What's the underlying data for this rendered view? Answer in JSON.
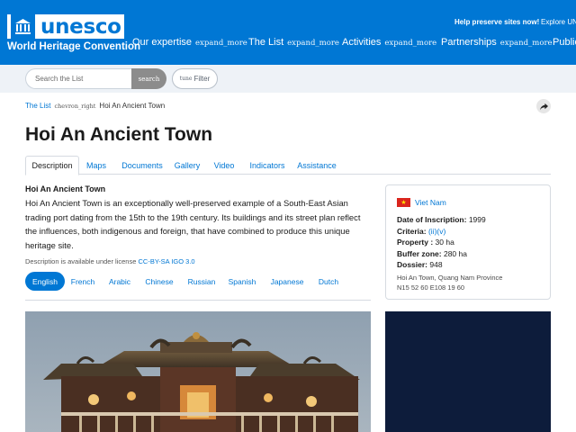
{
  "header": {
    "brand": "unesco",
    "subtitle": "World Heritage Convention",
    "preserve_link": "Help preserve sites now!",
    "explore_link": "Explore UNESCO",
    "nav": [
      {
        "label": "Our expertise",
        "icon": "expand_more"
      },
      {
        "label": "The List",
        "icon": "expand_more"
      },
      {
        "label": "Activities",
        "icon": "expand_more"
      },
      {
        "label": "Partnerships",
        "icon": "expand_more"
      },
      {
        "label": "Public"
      }
    ]
  },
  "search": {
    "placeholder": "Search the List",
    "button_label": "search",
    "filter_icon": "tune",
    "filter_label": "Filter"
  },
  "breadcrumb": {
    "root": "The List",
    "separator": "chevron_right",
    "current": "Hoi An Ancient Town"
  },
  "page": {
    "title": "Hoi An Ancient Town"
  },
  "tabs": [
    {
      "label": "Description",
      "active": true
    },
    {
      "label": "Maps"
    },
    {
      "label": "Documents"
    },
    {
      "label": "Gallery"
    },
    {
      "label": "Video"
    },
    {
      "label": "Indicators"
    },
    {
      "label": "Assistance"
    }
  ],
  "description": {
    "heading": "Hoi An Ancient Town",
    "body": "Hoi An Ancient Town is an exceptionally well-preserved example of a South-East Asian trading port dating from the 15th to the 19th century. Its buildings and its street plan reflect the influences, both indigenous and foreign, that have combined to produce this unique heritage site.",
    "license_prefix": "Description is available under license",
    "license_link": "CC-BY-SA IGO 3.0"
  },
  "languages": [
    {
      "label": "English",
      "active": true
    },
    {
      "label": "French"
    },
    {
      "label": "Arabic"
    },
    {
      "label": "Chinese"
    },
    {
      "label": "Russian"
    },
    {
      "label": "Spanish"
    },
    {
      "label": "Japanese"
    },
    {
      "label": "Dutch"
    }
  ],
  "info": {
    "country": "Viet Nam",
    "date_label": "Date of Inscription:",
    "date_value": "1999",
    "criteria_label": "Criteria:",
    "criteria_value": "(ii)(v)",
    "property_label": "Property :",
    "property_value": "30 ha",
    "buffer_label": "Buffer zone:",
    "buffer_value": "280 ha",
    "dossier_label": "Dossier:",
    "dossier_value": "948",
    "location": "Hoi An Town, Quang Nam Province",
    "coordinates": "N15 52 60 E108 19 60"
  },
  "colors": {
    "brand_blue": "#0077d4",
    "panel_dark": "#0d1c3b",
    "flag_red": "#da251d",
    "flag_star": "#ffde00"
  }
}
